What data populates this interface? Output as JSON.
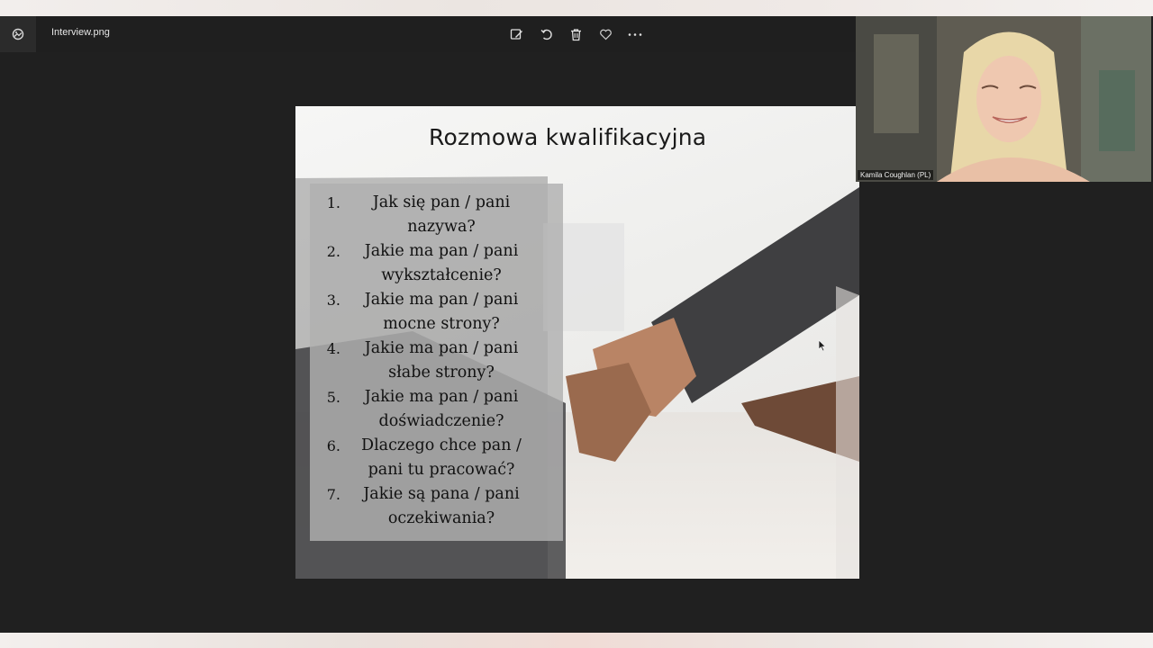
{
  "viewer": {
    "file_name": "Interview.png",
    "app_icon": "photos-app-icon",
    "toolbar": [
      {
        "name": "edit-image-button",
        "icon": "edit-icon"
      },
      {
        "name": "rotate-button",
        "icon": "rotate-icon"
      },
      {
        "name": "delete-button",
        "icon": "trash-icon"
      },
      {
        "name": "favorite-button",
        "icon": "heart-icon"
      },
      {
        "name": "more-options-button",
        "icon": "more-icon"
      }
    ]
  },
  "slide": {
    "title": "Rozmowa kwalifikacyjna",
    "questions": [
      {
        "num": "1.",
        "text": "Jak się pan / pani nazywa?"
      },
      {
        "num": "2.",
        "text": "Jakie ma pan / pani wykształcenie?"
      },
      {
        "num": "3.",
        "text": "Jakie ma pan / pani mocne strony?"
      },
      {
        "num": "4.",
        "text": "Jakie ma pan / pani słabe strony?"
      },
      {
        "num": "5.",
        "text": "Jakie ma pan / pani doświadczenie?"
      },
      {
        "num": "6.",
        "text": "Dlaczego chce pan / pani tu pracować?"
      },
      {
        "num": "7.",
        "text": "Jakie są pana / pani oczekiwania?"
      }
    ]
  },
  "webcam": {
    "participant_name": "Kamila Coughlan (PL)"
  },
  "colors": {
    "viewer_bg": "#202020",
    "question_box": "#b0b0b0",
    "title_text": "#1a1a1a"
  }
}
